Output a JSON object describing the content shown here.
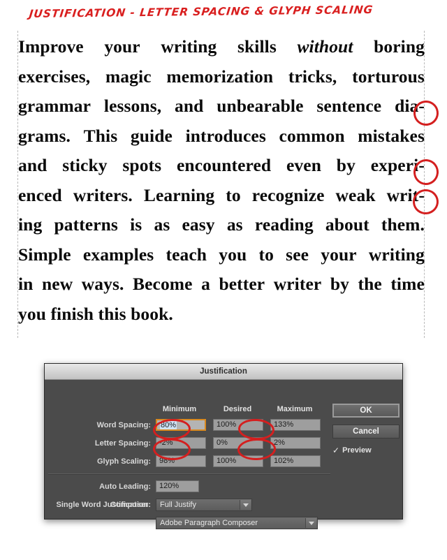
{
  "annotation": {
    "title": "JUSTIFICATION - LETTER SPACING & GLYPH SCALING",
    "color": "#d41f1f",
    "circled_hyphens": [
      "dia-",
      "experi-",
      "writ-"
    ],
    "circled_fields": [
      "letter_spacing_minimum",
      "letter_spacing_maximum",
      "glyph_scaling_minimum",
      "glyph_scaling_maximum"
    ]
  },
  "sample_text": {
    "lines": [
      {
        "words": [
          "Improve",
          "your",
          "writing",
          "skills",
          "without",
          "boring"
        ],
        "italic_word": "without"
      },
      {
        "words": [
          "exercises,",
          "magic",
          "memorization",
          "tricks,",
          "torturous"
        ]
      },
      {
        "words": [
          "grammar",
          "lessons,",
          "and",
          "unbearable",
          "sentence",
          "dia-"
        ]
      },
      {
        "words": [
          "grams.",
          "This",
          "guide",
          "introduces",
          "common",
          "mistakes"
        ]
      },
      {
        "words": [
          "and",
          "sticky",
          "spots",
          "encountered",
          "even",
          "by",
          "experi-"
        ]
      },
      {
        "words": [
          "enced",
          "writers.",
          "Learning",
          "to",
          "recognize",
          "weak",
          "writ-"
        ]
      },
      {
        "words": [
          "ing",
          "patterns",
          "is",
          "as",
          "easy",
          "as",
          "reading",
          "about",
          "them."
        ]
      },
      {
        "words": [
          "Simple",
          "examples",
          "teach",
          "you",
          "to",
          "see",
          "your",
          "writing"
        ]
      },
      {
        "words": [
          "in",
          "new",
          "ways.",
          "Become",
          "a",
          "better",
          "writer",
          "by",
          "the",
          "time"
        ]
      },
      {
        "words": [
          "you",
          "finish",
          "this",
          "book."
        ],
        "last": true
      }
    ],
    "plain": "Improve your writing skills without boring exercises, magic memorization tricks, torturous grammar lessons, and unbearable sentence diagrams. This guide introduces common mistakes and sticky spots encountered even by experienced writers. Learning to recognize weak writing patterns is as easy as reading about them. Simple examples teach you to see your writing in new ways. Become a better writer by the time you finish this book."
  },
  "dialog": {
    "title": "Justification",
    "columns": {
      "minimum": "Minimum",
      "desired": "Desired",
      "maximum": "Maximum"
    },
    "rows": [
      {
        "label": "Word Spacing:",
        "minimum": "80%",
        "desired": "100%",
        "maximum": "133%",
        "focused": "minimum"
      },
      {
        "label": "Letter Spacing:",
        "minimum": "-2%",
        "desired": "0%",
        "maximum": "2%"
      },
      {
        "label": "Glyph Scaling:",
        "minimum": "98%",
        "desired": "100%",
        "maximum": "102%"
      }
    ],
    "auto_leading": {
      "label": "Auto Leading:",
      "value": "120%"
    },
    "single_word_justification": {
      "label": "Single Word Justification:",
      "value": "Full Justify"
    },
    "composer": {
      "label": "Composer:",
      "value": "Adobe Paragraph Composer"
    },
    "buttons": {
      "ok": "OK",
      "cancel": "Cancel"
    },
    "preview": {
      "label": "Preview",
      "checked": true,
      "check_glyph": "✓"
    }
  }
}
